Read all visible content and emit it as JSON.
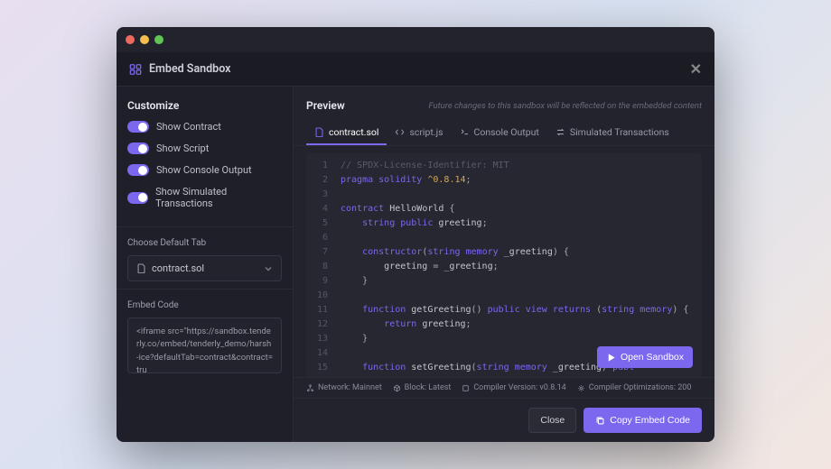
{
  "header": {
    "title": "Embed Sandbox"
  },
  "sidebar": {
    "customize_title": "Customize",
    "toggles": [
      {
        "label": "Show Contract"
      },
      {
        "label": "Show Script"
      },
      {
        "label": "Show Console Output"
      },
      {
        "label": "Show Simulated Transactions"
      }
    ],
    "default_tab_label": "Choose Default Tab",
    "default_tab_value": "contract.sol",
    "embed_code_label": "Embed Code",
    "embed_code_value": "<iframe src=\"https://sandbox.tenderly.co/embed/tenderly_demo/harsh-ice?defaultTab=contract&contract=tru"
  },
  "preview": {
    "title": "Preview",
    "note": "Future changes to this sandbox will be reflected on the embedded content",
    "tabs": [
      {
        "label": "contract.sol"
      },
      {
        "label": "script.js"
      },
      {
        "label": "Console Output"
      },
      {
        "label": "Simulated Transactions"
      }
    ],
    "open_sandbox": "Open Sandbox"
  },
  "code": {
    "lines": [
      {
        "n": "1"
      },
      {
        "n": "2"
      },
      {
        "n": "3"
      },
      {
        "n": "4"
      },
      {
        "n": "5"
      },
      {
        "n": "6"
      },
      {
        "n": "7"
      },
      {
        "n": "8"
      },
      {
        "n": "9"
      },
      {
        "n": "10"
      },
      {
        "n": "11"
      },
      {
        "n": "12"
      },
      {
        "n": "13"
      },
      {
        "n": "14"
      },
      {
        "n": "15"
      }
    ]
  },
  "status": {
    "network": "Network: Mainnet",
    "block": "Block: Latest",
    "compiler": "Compiler Version: v0.8.14",
    "optim": "Compiler Optimizations: 200"
  },
  "footer": {
    "close": "Close",
    "copy": "Copy Embed Code"
  }
}
